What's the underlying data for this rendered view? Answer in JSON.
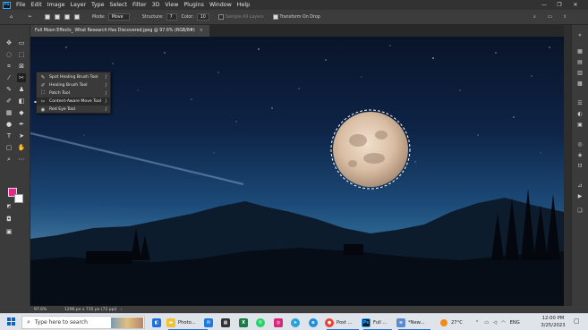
{
  "app": {
    "name": "Photoshop",
    "logo_text": "Ps",
    "menu": [
      "File",
      "Edit",
      "Image",
      "Layer",
      "Type",
      "Select",
      "Filter",
      "3D",
      "View",
      "Plugins",
      "Window",
      "Help"
    ]
  },
  "window_controls": {
    "minimize": "—",
    "maximize": "❐",
    "close": "✕"
  },
  "options_bar": {
    "mode_label": "Mode:",
    "mode_value": "Move",
    "structure_label": "Structure:",
    "structure_value": "7",
    "color_label": "Color:",
    "color_value": "10",
    "sample_all_layers": "Sample All Layers",
    "transform_on_drop": "Transform On Drop"
  },
  "document": {
    "tab_title": "Full Moon Effects_ What Research Has Discovered.jpeg @ 97.6% (RGB/8#)",
    "tab_close": "×"
  },
  "flyout": {
    "items": [
      {
        "label": "Spot Healing Brush Tool",
        "key": "J",
        "icon": "✎"
      },
      {
        "label": "Healing Brush Tool",
        "key": "J",
        "icon": "✐"
      },
      {
        "label": "Patch Tool",
        "key": "J",
        "icon": "⛶"
      },
      {
        "label": "Content-Aware Move Tool",
        "key": "J",
        "icon": "✂"
      },
      {
        "label": "Red Eye Tool",
        "key": "J",
        "icon": "◉"
      }
    ]
  },
  "status": {
    "zoom": "97.6%",
    "doc_info": "1296 px x 735 px (72 ppi)",
    "arrow": "›"
  },
  "colors": {
    "foreground": "#e8238a",
    "background": "#ffffff",
    "accent": "#31a8ff"
  },
  "taskbar": {
    "search_placeholder": "Type here to search",
    "apps": [
      {
        "label": "Photo...",
        "color": "#f3c233",
        "icon": "folder-icon"
      },
      {
        "label": "Post ...",
        "color": "#e94235",
        "icon": "chrome-icon"
      },
      {
        "label": "Full ...",
        "color": "#001e36",
        "icon": "photoshop-icon"
      },
      {
        "label": "*New...",
        "color": "#5a8ad0",
        "icon": "notepad-icon"
      }
    ],
    "weather": "27°C",
    "language": "ENG",
    "time": "12:00 PM",
    "date": "3/25/2023"
  }
}
